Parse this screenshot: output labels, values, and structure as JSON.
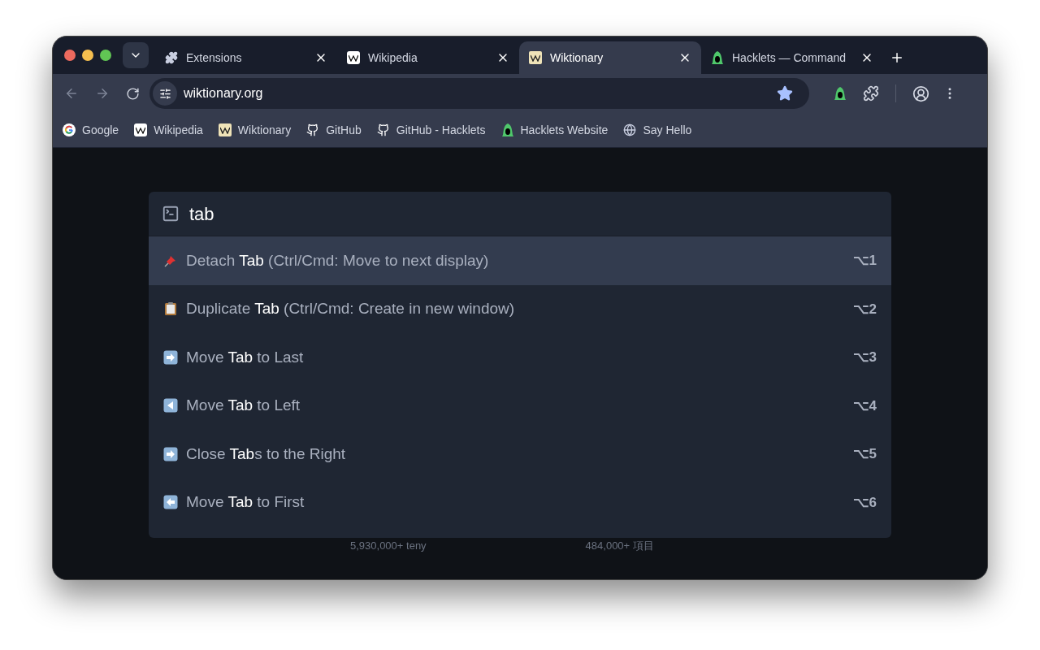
{
  "tabs": [
    {
      "label": "Extensions",
      "kind": "puzzle",
      "selected": false
    },
    {
      "label": "Wikipedia",
      "kind": "wikipedia",
      "selected": false
    },
    {
      "label": "Wiktionary",
      "kind": "wiktionary",
      "selected": true
    },
    {
      "label": "Hacklets — Command",
      "kind": "hood",
      "selected": false
    }
  ],
  "address_bar": {
    "value": "wiktionary.org",
    "bookmarked": true
  },
  "bookmarks": [
    {
      "label": "Google",
      "kind": "google"
    },
    {
      "label": "Wikipedia",
      "kind": "wikipedia"
    },
    {
      "label": "Wiktionary",
      "kind": "wiktionary"
    },
    {
      "label": "GitHub",
      "kind": "github"
    },
    {
      "label": "GitHub - Hacklets",
      "kind": "github"
    },
    {
      "label": "Hacklets Website",
      "kind": "hood"
    },
    {
      "label": "Say Hello",
      "kind": "globe"
    }
  ],
  "palette": {
    "query": "tab",
    "items": [
      {
        "label": "Detach **Tab** (Ctrl/Cmd: Move to next display)",
        "kind": "pin",
        "shortcut": "⌥1",
        "selected": true
      },
      {
        "label": "Duplicate **Tab** (Ctrl/Cmd: Create in new window)",
        "kind": "clipboard",
        "shortcut": "⌥2",
        "selected": false
      },
      {
        "label": "Move **Tab** to Last",
        "kind": "right",
        "shortcut": "⌥3",
        "selected": false
      },
      {
        "label": "Move **Tab** to Left",
        "kind": "triangle-left",
        "shortcut": "⌥4",
        "selected": false
      },
      {
        "label": "Close **Tab**s to the Right",
        "kind": "right",
        "shortcut": "⌥5",
        "selected": false
      },
      {
        "label": "Move **Tab** to First",
        "kind": "left",
        "shortcut": "⌥6",
        "selected": false
      }
    ]
  },
  "background_stats": [
    "5,930,000+ teny",
    "484,000+ 項目"
  ]
}
